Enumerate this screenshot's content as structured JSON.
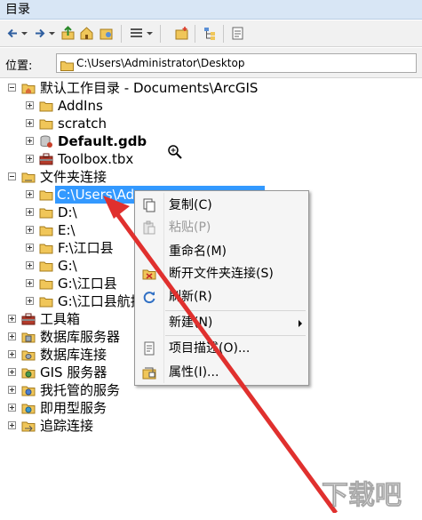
{
  "window": {
    "title": "目录"
  },
  "location": {
    "label": "位置:",
    "value": "C:\\Users\\Administrator\\Desktop"
  },
  "tree": {
    "root_home": "默认工作目录 - Documents\\ArcGIS",
    "home_children": [
      "AddIns",
      "scratch",
      "Default.gdb",
      "Toolbox.tbx"
    ],
    "folder_connections": "文件夹连接",
    "folders": [
      "C:\\Users\\Ad",
      "D:\\",
      "E:\\",
      "F:\\江口县",
      "G:\\",
      "G:\\江口县",
      "G:\\江口县航拍"
    ],
    "others": [
      "工具箱",
      "数据库服务器",
      "数据库连接",
      "GIS 服务器",
      "我托管的服务",
      "即用型服务",
      "追踪连接"
    ]
  },
  "context_menu": {
    "copy": "复制(C)",
    "paste": "粘贴(P)",
    "rename": "重命名(M)",
    "disconnect": "断开文件夹连接(S)",
    "refresh": "刷新(R)",
    "new": "新建(N)",
    "item_description": "项目描述(O)...",
    "properties": "属性(I)..."
  },
  "watermark": {
    "text": "下载吧"
  },
  "colors": {
    "selection": "#3399ff",
    "arrow": "#e0302e",
    "folder": "#f0c659"
  }
}
